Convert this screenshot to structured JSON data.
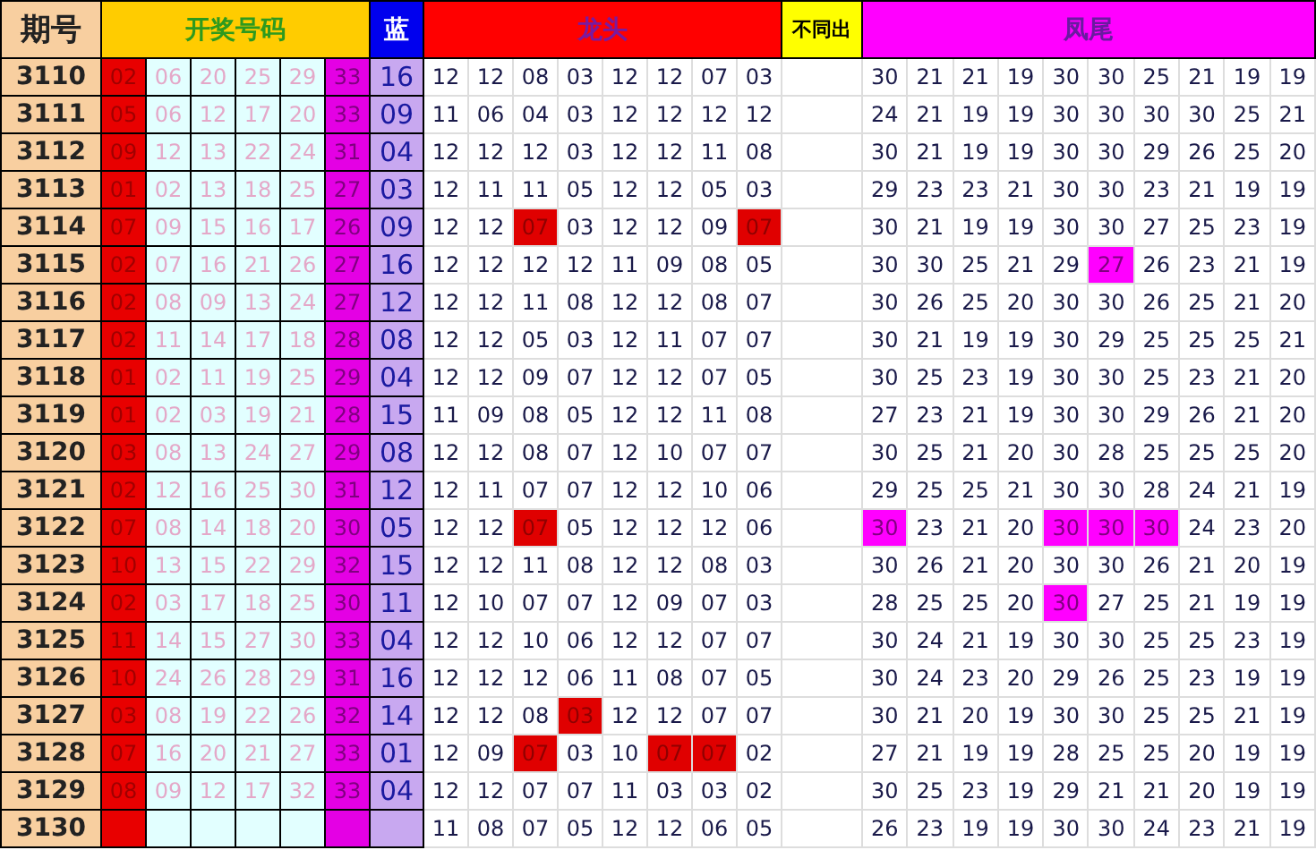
{
  "header": [
    {
      "kind": "period",
      "label": "期号"
    },
    {
      "kind": "draw",
      "label": "开奖号码"
    },
    {
      "kind": "blue",
      "label": "蓝"
    },
    {
      "kind": "head",
      "label": "龙头"
    },
    {
      "kind": "diff",
      "label": "不同出"
    },
    {
      "kind": "tail",
      "label": "凤尾"
    }
  ],
  "rows": [
    {
      "period": "3110",
      "draw": [
        "02",
        "06",
        "20",
        "25",
        "29",
        "33"
      ],
      "blue": "16",
      "head": [
        {
          "v": "12",
          "hit": false
        },
        {
          "v": "12",
          "hit": false
        },
        {
          "v": "08",
          "hit": false
        },
        {
          "v": "03",
          "hit": false
        },
        {
          "v": "12",
          "hit": false
        },
        {
          "v": "12",
          "hit": false
        },
        {
          "v": "07",
          "hit": false
        },
        {
          "v": "03",
          "hit": false
        }
      ],
      "tail": [
        {
          "v": "30",
          "hit": false
        },
        {
          "v": "21",
          "hit": false
        },
        {
          "v": "21",
          "hit": false
        },
        {
          "v": "19",
          "hit": false
        },
        {
          "v": "30",
          "hit": false
        },
        {
          "v": "30",
          "hit": false
        },
        {
          "v": "25",
          "hit": false
        },
        {
          "v": "21",
          "hit": false
        },
        {
          "v": "19",
          "hit": false
        },
        {
          "v": "19",
          "hit": false
        }
      ]
    },
    {
      "period": "3111",
      "draw": [
        "05",
        "06",
        "12",
        "17",
        "20",
        "33"
      ],
      "blue": "09",
      "head": [
        {
          "v": "11",
          "hit": false
        },
        {
          "v": "06",
          "hit": false
        },
        {
          "v": "04",
          "hit": false
        },
        {
          "v": "03",
          "hit": false
        },
        {
          "v": "12",
          "hit": false
        },
        {
          "v": "12",
          "hit": false
        },
        {
          "v": "12",
          "hit": false
        },
        {
          "v": "12",
          "hit": false
        }
      ],
      "tail": [
        {
          "v": "24",
          "hit": false
        },
        {
          "v": "21",
          "hit": false
        },
        {
          "v": "19",
          "hit": false
        },
        {
          "v": "19",
          "hit": false
        },
        {
          "v": "30",
          "hit": false
        },
        {
          "v": "30",
          "hit": false
        },
        {
          "v": "30",
          "hit": false
        },
        {
          "v": "30",
          "hit": false
        },
        {
          "v": "25",
          "hit": false
        },
        {
          "v": "21",
          "hit": false
        }
      ]
    },
    {
      "period": "3112",
      "draw": [
        "09",
        "12",
        "13",
        "22",
        "24",
        "31"
      ],
      "blue": "04",
      "head": [
        {
          "v": "12",
          "hit": false
        },
        {
          "v": "12",
          "hit": false
        },
        {
          "v": "12",
          "hit": false
        },
        {
          "v": "03",
          "hit": false
        },
        {
          "v": "12",
          "hit": false
        },
        {
          "v": "12",
          "hit": false
        },
        {
          "v": "11",
          "hit": false
        },
        {
          "v": "08",
          "hit": false
        }
      ],
      "tail": [
        {
          "v": "30",
          "hit": false
        },
        {
          "v": "21",
          "hit": false
        },
        {
          "v": "19",
          "hit": false
        },
        {
          "v": "19",
          "hit": false
        },
        {
          "v": "30",
          "hit": false
        },
        {
          "v": "30",
          "hit": false
        },
        {
          "v": "29",
          "hit": false
        },
        {
          "v": "26",
          "hit": false
        },
        {
          "v": "25",
          "hit": false
        },
        {
          "v": "20",
          "hit": false
        }
      ]
    },
    {
      "period": "3113",
      "draw": [
        "01",
        "02",
        "13",
        "18",
        "25",
        "27"
      ],
      "blue": "03",
      "head": [
        {
          "v": "12",
          "hit": false
        },
        {
          "v": "11",
          "hit": false
        },
        {
          "v": "11",
          "hit": false
        },
        {
          "v": "05",
          "hit": false
        },
        {
          "v": "12",
          "hit": false
        },
        {
          "v": "12",
          "hit": false
        },
        {
          "v": "05",
          "hit": false
        },
        {
          "v": "03",
          "hit": false
        }
      ],
      "tail": [
        {
          "v": "29",
          "hit": false
        },
        {
          "v": "23",
          "hit": false
        },
        {
          "v": "23",
          "hit": false
        },
        {
          "v": "21",
          "hit": false
        },
        {
          "v": "30",
          "hit": false
        },
        {
          "v": "30",
          "hit": false
        },
        {
          "v": "23",
          "hit": false
        },
        {
          "v": "21",
          "hit": false
        },
        {
          "v": "19",
          "hit": false
        },
        {
          "v": "19",
          "hit": false
        }
      ]
    },
    {
      "period": "3114",
      "draw": [
        "07",
        "09",
        "15",
        "16",
        "17",
        "26"
      ],
      "blue": "09",
      "head": [
        {
          "v": "12",
          "hit": false
        },
        {
          "v": "12",
          "hit": false
        },
        {
          "v": "07",
          "hit": true
        },
        {
          "v": "03",
          "hit": false
        },
        {
          "v": "12",
          "hit": false
        },
        {
          "v": "12",
          "hit": false
        },
        {
          "v": "09",
          "hit": false
        },
        {
          "v": "07",
          "hit": true
        }
      ],
      "tail": [
        {
          "v": "30",
          "hit": false
        },
        {
          "v": "21",
          "hit": false
        },
        {
          "v": "19",
          "hit": false
        },
        {
          "v": "19",
          "hit": false
        },
        {
          "v": "30",
          "hit": false
        },
        {
          "v": "30",
          "hit": false
        },
        {
          "v": "27",
          "hit": false
        },
        {
          "v": "25",
          "hit": false
        },
        {
          "v": "23",
          "hit": false
        },
        {
          "v": "19",
          "hit": false
        }
      ]
    },
    {
      "period": "3115",
      "draw": [
        "02",
        "07",
        "16",
        "21",
        "26",
        "27"
      ],
      "blue": "16",
      "head": [
        {
          "v": "12",
          "hit": false
        },
        {
          "v": "12",
          "hit": false
        },
        {
          "v": "12",
          "hit": false
        },
        {
          "v": "12",
          "hit": false
        },
        {
          "v": "11",
          "hit": false
        },
        {
          "v": "09",
          "hit": false
        },
        {
          "v": "08",
          "hit": false
        },
        {
          "v": "05",
          "hit": false
        }
      ],
      "tail": [
        {
          "v": "30",
          "hit": false
        },
        {
          "v": "30",
          "hit": false
        },
        {
          "v": "25",
          "hit": false
        },
        {
          "v": "21",
          "hit": false
        },
        {
          "v": "29",
          "hit": false
        },
        {
          "v": "27",
          "hit": true
        },
        {
          "v": "26",
          "hit": false
        },
        {
          "v": "23",
          "hit": false
        },
        {
          "v": "21",
          "hit": false
        },
        {
          "v": "19",
          "hit": false
        }
      ]
    },
    {
      "period": "3116",
      "draw": [
        "02",
        "08",
        "09",
        "13",
        "24",
        "27"
      ],
      "blue": "12",
      "head": [
        {
          "v": "12",
          "hit": false
        },
        {
          "v": "12",
          "hit": false
        },
        {
          "v": "11",
          "hit": false
        },
        {
          "v": "08",
          "hit": false
        },
        {
          "v": "12",
          "hit": false
        },
        {
          "v": "12",
          "hit": false
        },
        {
          "v": "08",
          "hit": false
        },
        {
          "v": "07",
          "hit": false
        }
      ],
      "tail": [
        {
          "v": "30",
          "hit": false
        },
        {
          "v": "26",
          "hit": false
        },
        {
          "v": "25",
          "hit": false
        },
        {
          "v": "20",
          "hit": false
        },
        {
          "v": "30",
          "hit": false
        },
        {
          "v": "30",
          "hit": false
        },
        {
          "v": "26",
          "hit": false
        },
        {
          "v": "25",
          "hit": false
        },
        {
          "v": "21",
          "hit": false
        },
        {
          "v": "20",
          "hit": false
        }
      ]
    },
    {
      "period": "3117",
      "draw": [
        "02",
        "11",
        "14",
        "17",
        "18",
        "28"
      ],
      "blue": "08",
      "head": [
        {
          "v": "12",
          "hit": false
        },
        {
          "v": "12",
          "hit": false
        },
        {
          "v": "05",
          "hit": false
        },
        {
          "v": "03",
          "hit": false
        },
        {
          "v": "12",
          "hit": false
        },
        {
          "v": "11",
          "hit": false
        },
        {
          "v": "07",
          "hit": false
        },
        {
          "v": "07",
          "hit": false
        }
      ],
      "tail": [
        {
          "v": "30",
          "hit": false
        },
        {
          "v": "21",
          "hit": false
        },
        {
          "v": "19",
          "hit": false
        },
        {
          "v": "19",
          "hit": false
        },
        {
          "v": "30",
          "hit": false
        },
        {
          "v": "29",
          "hit": false
        },
        {
          "v": "25",
          "hit": false
        },
        {
          "v": "25",
          "hit": false
        },
        {
          "v": "25",
          "hit": false
        },
        {
          "v": "21",
          "hit": false
        }
      ]
    },
    {
      "period": "3118",
      "draw": [
        "01",
        "02",
        "11",
        "19",
        "25",
        "29"
      ],
      "blue": "04",
      "head": [
        {
          "v": "12",
          "hit": false
        },
        {
          "v": "12",
          "hit": false
        },
        {
          "v": "09",
          "hit": false
        },
        {
          "v": "07",
          "hit": false
        },
        {
          "v": "12",
          "hit": false
        },
        {
          "v": "12",
          "hit": false
        },
        {
          "v": "07",
          "hit": false
        },
        {
          "v": "05",
          "hit": false
        }
      ],
      "tail": [
        {
          "v": "30",
          "hit": false
        },
        {
          "v": "25",
          "hit": false
        },
        {
          "v": "23",
          "hit": false
        },
        {
          "v": "19",
          "hit": false
        },
        {
          "v": "30",
          "hit": false
        },
        {
          "v": "30",
          "hit": false
        },
        {
          "v": "25",
          "hit": false
        },
        {
          "v": "23",
          "hit": false
        },
        {
          "v": "21",
          "hit": false
        },
        {
          "v": "20",
          "hit": false
        }
      ]
    },
    {
      "period": "3119",
      "draw": [
        "01",
        "02",
        "03",
        "19",
        "21",
        "28"
      ],
      "blue": "15",
      "head": [
        {
          "v": "11",
          "hit": false
        },
        {
          "v": "09",
          "hit": false
        },
        {
          "v": "08",
          "hit": false
        },
        {
          "v": "05",
          "hit": false
        },
        {
          "v": "12",
          "hit": false
        },
        {
          "v": "12",
          "hit": false
        },
        {
          "v": "11",
          "hit": false
        },
        {
          "v": "08",
          "hit": false
        }
      ],
      "tail": [
        {
          "v": "27",
          "hit": false
        },
        {
          "v": "23",
          "hit": false
        },
        {
          "v": "21",
          "hit": false
        },
        {
          "v": "19",
          "hit": false
        },
        {
          "v": "30",
          "hit": false
        },
        {
          "v": "30",
          "hit": false
        },
        {
          "v": "29",
          "hit": false
        },
        {
          "v": "26",
          "hit": false
        },
        {
          "v": "21",
          "hit": false
        },
        {
          "v": "20",
          "hit": false
        }
      ]
    },
    {
      "period": "3120",
      "draw": [
        "03",
        "08",
        "13",
        "24",
        "27",
        "29"
      ],
      "blue": "08",
      "head": [
        {
          "v": "12",
          "hit": false
        },
        {
          "v": "12",
          "hit": false
        },
        {
          "v": "08",
          "hit": false
        },
        {
          "v": "07",
          "hit": false
        },
        {
          "v": "12",
          "hit": false
        },
        {
          "v": "10",
          "hit": false
        },
        {
          "v": "07",
          "hit": false
        },
        {
          "v": "07",
          "hit": false
        }
      ],
      "tail": [
        {
          "v": "30",
          "hit": false
        },
        {
          "v": "25",
          "hit": false
        },
        {
          "v": "21",
          "hit": false
        },
        {
          "v": "20",
          "hit": false
        },
        {
          "v": "30",
          "hit": false
        },
        {
          "v": "28",
          "hit": false
        },
        {
          "v": "25",
          "hit": false
        },
        {
          "v": "25",
          "hit": false
        },
        {
          "v": "25",
          "hit": false
        },
        {
          "v": "20",
          "hit": false
        }
      ]
    },
    {
      "period": "3121",
      "draw": [
        "02",
        "12",
        "16",
        "25",
        "30",
        "31"
      ],
      "blue": "12",
      "head": [
        {
          "v": "12",
          "hit": false
        },
        {
          "v": "11",
          "hit": false
        },
        {
          "v": "07",
          "hit": false
        },
        {
          "v": "07",
          "hit": false
        },
        {
          "v": "12",
          "hit": false
        },
        {
          "v": "12",
          "hit": false
        },
        {
          "v": "10",
          "hit": false
        },
        {
          "v": "06",
          "hit": false
        }
      ],
      "tail": [
        {
          "v": "29",
          "hit": false
        },
        {
          "v": "25",
          "hit": false
        },
        {
          "v": "25",
          "hit": false
        },
        {
          "v": "21",
          "hit": false
        },
        {
          "v": "30",
          "hit": false
        },
        {
          "v": "30",
          "hit": false
        },
        {
          "v": "28",
          "hit": false
        },
        {
          "v": "24",
          "hit": false
        },
        {
          "v": "21",
          "hit": false
        },
        {
          "v": "19",
          "hit": false
        }
      ]
    },
    {
      "period": "3122",
      "draw": [
        "07",
        "08",
        "14",
        "18",
        "20",
        "30"
      ],
      "blue": "05",
      "head": [
        {
          "v": "12",
          "hit": false
        },
        {
          "v": "12",
          "hit": false
        },
        {
          "v": "07",
          "hit": true
        },
        {
          "v": "05",
          "hit": false
        },
        {
          "v": "12",
          "hit": false
        },
        {
          "v": "12",
          "hit": false
        },
        {
          "v": "12",
          "hit": false
        },
        {
          "v": "06",
          "hit": false
        }
      ],
      "tail": [
        {
          "v": "30",
          "hit": true
        },
        {
          "v": "23",
          "hit": false
        },
        {
          "v": "21",
          "hit": false
        },
        {
          "v": "20",
          "hit": false
        },
        {
          "v": "30",
          "hit": true
        },
        {
          "v": "30",
          "hit": true
        },
        {
          "v": "30",
          "hit": true
        },
        {
          "v": "24",
          "hit": false
        },
        {
          "v": "23",
          "hit": false
        },
        {
          "v": "20",
          "hit": false
        }
      ]
    },
    {
      "period": "3123",
      "draw": [
        "10",
        "13",
        "15",
        "22",
        "29",
        "32"
      ],
      "blue": "15",
      "head": [
        {
          "v": "12",
          "hit": false
        },
        {
          "v": "12",
          "hit": false
        },
        {
          "v": "11",
          "hit": false
        },
        {
          "v": "08",
          "hit": false
        },
        {
          "v": "12",
          "hit": false
        },
        {
          "v": "12",
          "hit": false
        },
        {
          "v": "08",
          "hit": false
        },
        {
          "v": "03",
          "hit": false
        }
      ],
      "tail": [
        {
          "v": "30",
          "hit": false
        },
        {
          "v": "26",
          "hit": false
        },
        {
          "v": "21",
          "hit": false
        },
        {
          "v": "20",
          "hit": false
        },
        {
          "v": "30",
          "hit": false
        },
        {
          "v": "30",
          "hit": false
        },
        {
          "v": "26",
          "hit": false
        },
        {
          "v": "21",
          "hit": false
        },
        {
          "v": "20",
          "hit": false
        },
        {
          "v": "19",
          "hit": false
        }
      ]
    },
    {
      "period": "3124",
      "draw": [
        "02",
        "03",
        "17",
        "18",
        "25",
        "30"
      ],
      "blue": "11",
      "head": [
        {
          "v": "12",
          "hit": false
        },
        {
          "v": "10",
          "hit": false
        },
        {
          "v": "07",
          "hit": false
        },
        {
          "v": "07",
          "hit": false
        },
        {
          "v": "12",
          "hit": false
        },
        {
          "v": "09",
          "hit": false
        },
        {
          "v": "07",
          "hit": false
        },
        {
          "v": "03",
          "hit": false
        }
      ],
      "tail": [
        {
          "v": "28",
          "hit": false
        },
        {
          "v": "25",
          "hit": false
        },
        {
          "v": "25",
          "hit": false
        },
        {
          "v": "20",
          "hit": false
        },
        {
          "v": "30",
          "hit": true
        },
        {
          "v": "27",
          "hit": false
        },
        {
          "v": "25",
          "hit": false
        },
        {
          "v": "21",
          "hit": false
        },
        {
          "v": "19",
          "hit": false
        },
        {
          "v": "19",
          "hit": false
        }
      ]
    },
    {
      "period": "3125",
      "draw": [
        "11",
        "14",
        "15",
        "27",
        "30",
        "33"
      ],
      "blue": "04",
      "head": [
        {
          "v": "12",
          "hit": false
        },
        {
          "v": "12",
          "hit": false
        },
        {
          "v": "10",
          "hit": false
        },
        {
          "v": "06",
          "hit": false
        },
        {
          "v": "12",
          "hit": false
        },
        {
          "v": "12",
          "hit": false
        },
        {
          "v": "07",
          "hit": false
        },
        {
          "v": "07",
          "hit": false
        }
      ],
      "tail": [
        {
          "v": "30",
          "hit": false
        },
        {
          "v": "24",
          "hit": false
        },
        {
          "v": "21",
          "hit": false
        },
        {
          "v": "19",
          "hit": false
        },
        {
          "v": "30",
          "hit": false
        },
        {
          "v": "30",
          "hit": false
        },
        {
          "v": "25",
          "hit": false
        },
        {
          "v": "25",
          "hit": false
        },
        {
          "v": "23",
          "hit": false
        },
        {
          "v": "19",
          "hit": false
        }
      ]
    },
    {
      "period": "3126",
      "draw": [
        "10",
        "24",
        "26",
        "28",
        "29",
        "31"
      ],
      "blue": "16",
      "head": [
        {
          "v": "12",
          "hit": false
        },
        {
          "v": "12",
          "hit": false
        },
        {
          "v": "12",
          "hit": false
        },
        {
          "v": "06",
          "hit": false
        },
        {
          "v": "11",
          "hit": false
        },
        {
          "v": "08",
          "hit": false
        },
        {
          "v": "07",
          "hit": false
        },
        {
          "v": "05",
          "hit": false
        }
      ],
      "tail": [
        {
          "v": "30",
          "hit": false
        },
        {
          "v": "24",
          "hit": false
        },
        {
          "v": "23",
          "hit": false
        },
        {
          "v": "20",
          "hit": false
        },
        {
          "v": "29",
          "hit": false
        },
        {
          "v": "26",
          "hit": false
        },
        {
          "v": "25",
          "hit": false
        },
        {
          "v": "23",
          "hit": false
        },
        {
          "v": "19",
          "hit": false
        },
        {
          "v": "19",
          "hit": false
        }
      ]
    },
    {
      "period": "3127",
      "draw": [
        "03",
        "08",
        "19",
        "22",
        "26",
        "32"
      ],
      "blue": "14",
      "head": [
        {
          "v": "12",
          "hit": false
        },
        {
          "v": "12",
          "hit": false
        },
        {
          "v": "08",
          "hit": false
        },
        {
          "v": "03",
          "hit": true
        },
        {
          "v": "12",
          "hit": false
        },
        {
          "v": "12",
          "hit": false
        },
        {
          "v": "07",
          "hit": false
        },
        {
          "v": "07",
          "hit": false
        }
      ],
      "tail": [
        {
          "v": "30",
          "hit": false
        },
        {
          "v": "21",
          "hit": false
        },
        {
          "v": "20",
          "hit": false
        },
        {
          "v": "19",
          "hit": false
        },
        {
          "v": "30",
          "hit": false
        },
        {
          "v": "30",
          "hit": false
        },
        {
          "v": "25",
          "hit": false
        },
        {
          "v": "25",
          "hit": false
        },
        {
          "v": "21",
          "hit": false
        },
        {
          "v": "19",
          "hit": false
        }
      ]
    },
    {
      "period": "3128",
      "draw": [
        "07",
        "16",
        "20",
        "21",
        "27",
        "33"
      ],
      "blue": "01",
      "head": [
        {
          "v": "12",
          "hit": false
        },
        {
          "v": "09",
          "hit": false
        },
        {
          "v": "07",
          "hit": true
        },
        {
          "v": "03",
          "hit": false
        },
        {
          "v": "10",
          "hit": false
        },
        {
          "v": "07",
          "hit": true
        },
        {
          "v": "07",
          "hit": true
        },
        {
          "v": "02",
          "hit": false
        }
      ],
      "tail": [
        {
          "v": "27",
          "hit": false
        },
        {
          "v": "21",
          "hit": false
        },
        {
          "v": "19",
          "hit": false
        },
        {
          "v": "19",
          "hit": false
        },
        {
          "v": "28",
          "hit": false
        },
        {
          "v": "25",
          "hit": false
        },
        {
          "v": "25",
          "hit": false
        },
        {
          "v": "20",
          "hit": false
        },
        {
          "v": "19",
          "hit": false
        },
        {
          "v": "19",
          "hit": false
        }
      ]
    },
    {
      "period": "3129",
      "draw": [
        "08",
        "09",
        "12",
        "17",
        "32",
        "33"
      ],
      "blue": "04",
      "head": [
        {
          "v": "12",
          "hit": false
        },
        {
          "v": "12",
          "hit": false
        },
        {
          "v": "07",
          "hit": false
        },
        {
          "v": "07",
          "hit": false
        },
        {
          "v": "11",
          "hit": false
        },
        {
          "v": "03",
          "hit": false
        },
        {
          "v": "03",
          "hit": false
        },
        {
          "v": "02",
          "hit": false
        }
      ],
      "tail": [
        {
          "v": "30",
          "hit": false
        },
        {
          "v": "25",
          "hit": false
        },
        {
          "v": "23",
          "hit": false
        },
        {
          "v": "19",
          "hit": false
        },
        {
          "v": "29",
          "hit": false
        },
        {
          "v": "21",
          "hit": false
        },
        {
          "v": "21",
          "hit": false
        },
        {
          "v": "20",
          "hit": false
        },
        {
          "v": "19",
          "hit": false
        },
        {
          "v": "19",
          "hit": false
        }
      ]
    },
    {
      "period": "3130",
      "head": [
        {
          "v": "11",
          "hit": false
        },
        {
          "v": "08",
          "hit": false
        },
        {
          "v": "07",
          "hit": false
        },
        {
          "v": "05",
          "hit": false
        },
        {
          "v": "12",
          "hit": false
        },
        {
          "v": "12",
          "hit": false
        },
        {
          "v": "06",
          "hit": false
        },
        {
          "v": "05",
          "hit": false
        }
      ],
      "tail": [
        {
          "v": "26",
          "hit": false
        },
        {
          "v": "23",
          "hit": false
        },
        {
          "v": "19",
          "hit": false
        },
        {
          "v": "19",
          "hit": false
        },
        {
          "v": "30",
          "hit": false
        },
        {
          "v": "30",
          "hit": false
        },
        {
          "v": "24",
          "hit": false
        },
        {
          "v": "23",
          "hit": false
        },
        {
          "v": "21",
          "hit": false
        },
        {
          "v": "19",
          "hit": false
        }
      ]
    }
  ]
}
